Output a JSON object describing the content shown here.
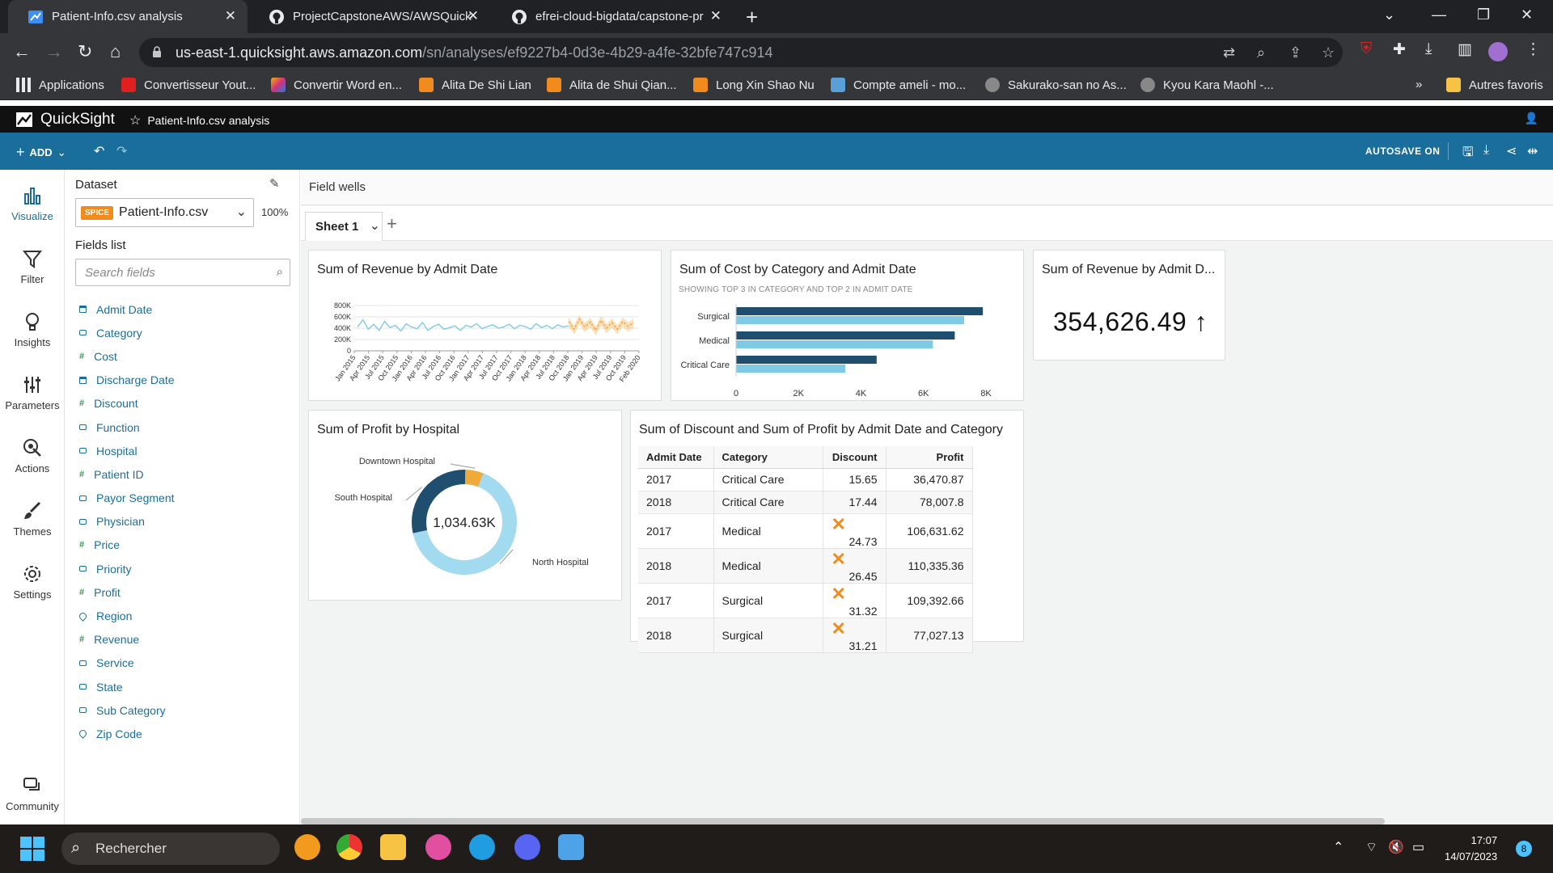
{
  "browser": {
    "tabs": [
      {
        "title": "Patient-Info.csv analysis",
        "active": true
      },
      {
        "title": "ProjectCapstoneAWS/AWSQuickS",
        "active": false
      },
      {
        "title": "efrei-cloud-bigdata/capstone-pr",
        "active": false
      }
    ],
    "url_host": "us-east-1.quicksight.aws.amazon.com",
    "url_path": "/sn/analyses/ef9227b4-0d3e-4b29-a4fe-32bfe747c914",
    "bookmarks": [
      {
        "label": "Applications",
        "icon": "apps-grid-icon",
        "color": "#e8eaed"
      },
      {
        "label": "Convertisseur Yout...",
        "icon": "youtube-icon",
        "color": "#e02020"
      },
      {
        "label": "Convertir Word en...",
        "icon": "word-converter-icon",
        "color": "#f6b300"
      },
      {
        "label": "Alita De Shi Lian",
        "icon": "manga-icon",
        "color": "#f28b1e"
      },
      {
        "label": "Alita de Shui Qian...",
        "icon": "manga-icon",
        "color": "#f28b1e"
      },
      {
        "label": "Long Xin Shao Nu",
        "icon": "manga-icon",
        "color": "#f28b1e"
      },
      {
        "label": "Compte ameli - mo...",
        "icon": "ameli-icon",
        "color": "#5a9fd6"
      },
      {
        "label": "Sakurako-san no As...",
        "icon": "ghost-icon",
        "color": "#999999"
      },
      {
        "label": "Kyou Kara Maohl -...",
        "icon": "ghost-icon",
        "color": "#999999"
      }
    ],
    "bookmarks_overflow": "»",
    "other_bookmarks": "Autres favoris"
  },
  "quicksight": {
    "brand": "QuickSight",
    "analysis_name": "Patient-Info.csv analysis",
    "toolbar": {
      "add_label": "ADD",
      "autosave_label": "AUTOSAVE ON"
    },
    "rail": [
      {
        "label": "Visualize",
        "icon": "visualize-icon",
        "active": true
      },
      {
        "label": "Filter",
        "icon": "filter-icon",
        "active": false
      },
      {
        "label": "Insights",
        "icon": "insights-icon",
        "active": false
      },
      {
        "label": "Parameters",
        "icon": "parameters-icon",
        "active": false
      },
      {
        "label": "Actions",
        "icon": "actions-icon",
        "active": false
      },
      {
        "label": "Themes",
        "icon": "themes-icon",
        "active": false
      },
      {
        "label": "Settings",
        "icon": "settings-icon",
        "active": false
      }
    ],
    "community_label": "Community",
    "dataset": {
      "heading": "Dataset",
      "badge": "SPICE",
      "name": "Patient-Info.csv",
      "spice_usage": "100%",
      "fields_heading": "Fields list",
      "search_placeholder": "Search fields",
      "fields": [
        {
          "name": "Admit Date",
          "type": "date"
        },
        {
          "name": "Category",
          "type": "dimension"
        },
        {
          "name": "Cost",
          "type": "measure"
        },
        {
          "name": "Discharge Date",
          "type": "date"
        },
        {
          "name": "Discount",
          "type": "measure"
        },
        {
          "name": "Function",
          "type": "dimension"
        },
        {
          "name": "Hospital",
          "type": "dimension"
        },
        {
          "name": "Patient ID",
          "type": "measure"
        },
        {
          "name": "Payor Segment",
          "type": "dimension"
        },
        {
          "name": "Physician",
          "type": "dimension"
        },
        {
          "name": "Price",
          "type": "measure"
        },
        {
          "name": "Priority",
          "type": "dimension"
        },
        {
          "name": "Profit",
          "type": "measure"
        },
        {
          "name": "Region",
          "type": "geo"
        },
        {
          "name": "Revenue",
          "type": "measure"
        },
        {
          "name": "Service",
          "type": "dimension"
        },
        {
          "name": "State",
          "type": "dimension"
        },
        {
          "name": "Sub Category",
          "type": "dimension"
        },
        {
          "name": "Zip Code",
          "type": "geo"
        }
      ]
    },
    "field_wells_label": "Field wells",
    "sheet_name": "Sheet 1",
    "visuals": {
      "line_title": "Sum of Revenue by Admit Date",
      "bar_title": "Sum of Cost by Category and Admit Date",
      "bar_subtitle": "SHOWING TOP 3 IN CATEGORY AND TOP 2 IN ADMIT DATE",
      "kpi_title": "Sum of Revenue by Admit D...",
      "kpi_value": "354,626.49",
      "kpi_trend": "↑",
      "donut_title": "Sum of Profit by Hospital",
      "donut_center": "1,034.63K",
      "table_title": "Sum of Discount and Sum of Profit by Admit Date and Category",
      "table_headers": [
        "Admit Date",
        "Category",
        "Discount",
        "Profit"
      ],
      "table_rows": [
        {
          "date": "2017",
          "category": "Critical Care",
          "discount": "15.65",
          "flag": false,
          "profit": "36,470.87"
        },
        {
          "date": "2018",
          "category": "Critical Care",
          "discount": "17.44",
          "flag": false,
          "profit": "78,007.8"
        },
        {
          "date": "2017",
          "category": "Medical",
          "discount": "24.73",
          "flag": true,
          "profit": "106,631.62"
        },
        {
          "date": "2018",
          "category": "Medical",
          "discount": "26.45",
          "flag": true,
          "profit": "110,335.36"
        },
        {
          "date": "2017",
          "category": "Surgical",
          "discount": "31.32",
          "flag": true,
          "profit": "109,392.66"
        },
        {
          "date": "2018",
          "category": "Surgical",
          "discount": "31.21",
          "flag": true,
          "profit": "77,027.13"
        }
      ]
    }
  },
  "chart_data": [
    {
      "type": "line",
      "title": "Sum of Revenue by Admit Date",
      "y_ticks": [
        "800K",
        "600K",
        "400K",
        "200K",
        "0"
      ],
      "ylim": [
        0,
        800000
      ],
      "x_ticks": [
        "Jan 2015",
        "Apr 2015",
        "Jul 2015",
        "Oct 2015",
        "Jan 2016",
        "Apr 2016",
        "Jul 2016",
        "Oct 2016",
        "Jan 2017",
        "Apr 2017",
        "Jul 2017",
        "Oct 2017",
        "Jan 2018",
        "Apr 2018",
        "Jul 2018",
        "Oct 2018",
        "Jan 2019",
        "Apr 2019",
        "Jul 2019",
        "Oct 2019",
        "Feb 2020"
      ],
      "series": [
        {
          "color": "#7fcbe6",
          "values": [
            420000,
            550000,
            380000,
            470000,
            360000,
            520000,
            410000,
            450000,
            350000,
            480000,
            420000,
            390000,
            500000,
            360000,
            430000,
            470000,
            380000,
            410000,
            440000,
            360000,
            450000,
            420000,
            480000,
            390000,
            430000,
            460000,
            400000,
            420000,
            470000,
            390000,
            450000,
            430000,
            380000,
            480000,
            410000,
            450000,
            390000,
            460000,
            420000,
            440000
          ]
        },
        {
          "color": "#f0a93b",
          "forecast": true,
          "values": [
            520000,
            380000,
            560000,
            420000,
            510000,
            360000,
            540000,
            400000,
            500000,
            380000,
            520000,
            430000,
            500000
          ]
        }
      ]
    },
    {
      "type": "bar",
      "orientation": "horizontal",
      "title": "Sum of Cost by Category and Admit Date",
      "categories": [
        "Surgical",
        "Medical",
        "Critical Care"
      ],
      "x_ticks": [
        "0",
        "2K",
        "4K",
        "6K",
        "8K"
      ],
      "xlim": [
        0,
        8000
      ],
      "series": [
        {
          "color": "#1f4e6e",
          "values": [
            7900,
            7000,
            4500
          ]
        },
        {
          "color": "#7fcbe6",
          "values": [
            7300,
            6300,
            3500
          ]
        }
      ]
    },
    {
      "type": "pie",
      "title": "Sum of Profit by Hospital",
      "slices": [
        {
          "label": "Downtown Hospital",
          "value": 58000,
          "color": "#f0a93b"
        },
        {
          "label": "North Hospital",
          "value": 680000,
          "color": "#a2daf0"
        },
        {
          "label": "South Hospital",
          "value": 296630,
          "color": "#1f4e6e"
        }
      ]
    }
  ]
}
